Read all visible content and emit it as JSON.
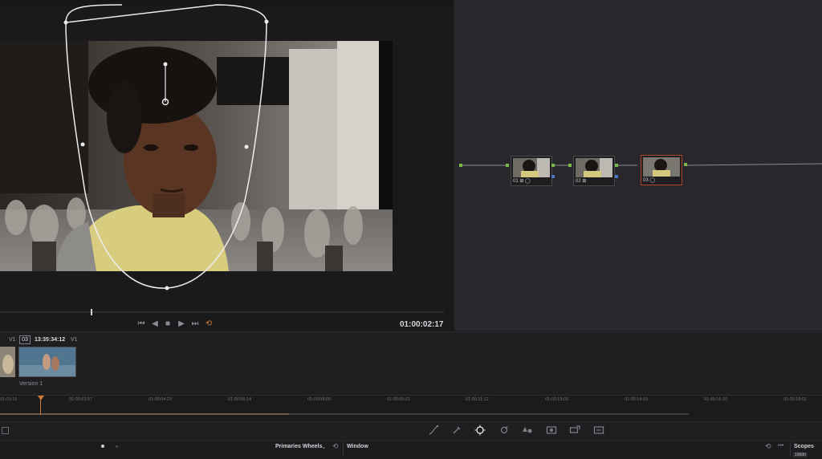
{
  "viewer": {
    "timecode": "01:00:02:17",
    "transport": {
      "first_frame": "⏮",
      "reverse": "◀",
      "stop": "■",
      "play": "▶",
      "last_frame": "⏭",
      "loop": "⟲"
    }
  },
  "nodes": [
    {
      "label": "01 ⊞ ◯"
    },
    {
      "label": "02 ⊞"
    },
    {
      "label": "03 ◯"
    }
  ],
  "clips": {
    "track_left": "V1",
    "clip_number": "03",
    "clip_timecode": "13:35:34:12",
    "track_right": "V1",
    "version": "Version 1"
  },
  "timeline": {
    "ticks": [
      "01:01:16",
      "01:00:03:07",
      "01:00:04:23",
      "01:00:06:14",
      "01:00:08:05",
      "01:00:09:21",
      "01:00:11:12",
      "01:00:13:03",
      "01:00:14:19",
      "01:00:16:10",
      "01:00:18:01"
    ]
  },
  "panel": {
    "primaries_label": "Primaries Wheels",
    "primaries_chevron": "⌄",
    "reset_icon": "⟲",
    "window_label": "Window",
    "more_icon": "•••",
    "scopes_label": "Scopes",
    "scope_value": "10000"
  },
  "colors": {
    "accent_orange": "#d07a32",
    "node_selected": "#b04a2e",
    "port_green": "#7db84a",
    "port_blue": "#4a74c9"
  }
}
